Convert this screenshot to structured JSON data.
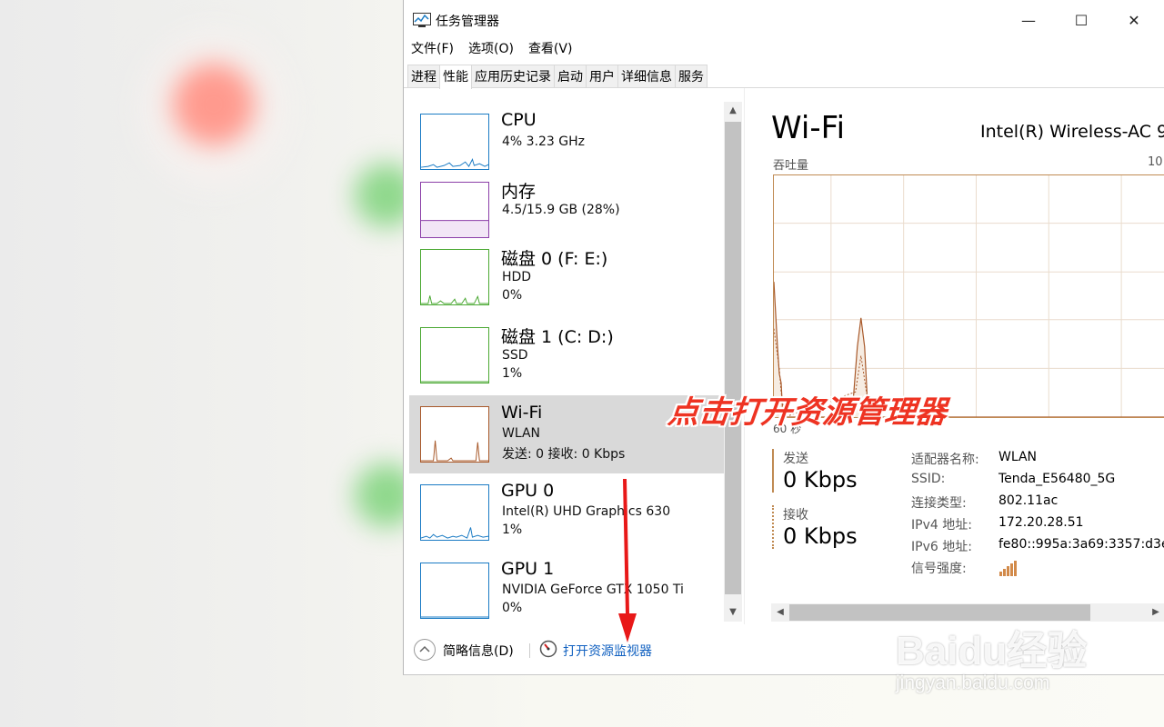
{
  "window": {
    "title": "任务管理器",
    "controls": {
      "minimize": "—",
      "maximize": "☐",
      "close": "✕"
    }
  },
  "menu": [
    "文件(F)",
    "选项(O)",
    "查看(V)"
  ],
  "tabs": [
    "进程",
    "性能",
    "应用历史记录",
    "启动",
    "用户",
    "详细信息",
    "服务"
  ],
  "active_tab": "性能",
  "devices": [
    {
      "name": "CPU",
      "sub1": "4% 3.23 GHz",
      "sub2": "",
      "color": "#1a7bc4",
      "level": 0.04
    },
    {
      "name": "内存",
      "sub1": "4.5/15.9 GB (28%)",
      "sub2": "",
      "color": "#8b3fa8",
      "level": 0.28
    },
    {
      "name": "磁盘 0 (F: E:)",
      "sub1": "HDD",
      "sub2": "0%",
      "color": "#4aa832",
      "level": 0.0
    },
    {
      "name": "磁盘 1 (C: D:)",
      "sub1": "SSD",
      "sub2": "1%",
      "color": "#4aa832",
      "level": 0.01
    },
    {
      "name": "Wi-Fi",
      "sub1": "WLAN",
      "sub2": "发送: 0 接收: 0 Kbps",
      "color": "#a8592a",
      "level": 0.0,
      "selected": true
    },
    {
      "name": "GPU 0",
      "sub1": "Intel(R) UHD Graphics 630",
      "sub2": "1%",
      "color": "#1a7bc4",
      "level": 0.01
    },
    {
      "name": "GPU 1",
      "sub1": "NVIDIA GeForce GTX 1050 Ti",
      "sub2": "0%",
      "color": "#1a7bc4",
      "level": 0.0
    }
  ],
  "detail": {
    "title": "Wi-Fi",
    "adapter": "Intel(R) Wireless-AC 9",
    "throughput_label": "吞吐量",
    "throughput_max": "10",
    "throughput_min": "60 秒",
    "send_label": "发送",
    "send_value": "0 Kbps",
    "recv_label": "接收",
    "recv_value": "0 Kbps",
    "properties": [
      {
        "key": "适配器名称:",
        "value": "WLAN"
      },
      {
        "key": "SSID:",
        "value": "Tenda_E56480_5G"
      },
      {
        "key": "连接类型:",
        "value": "802.11ac"
      },
      {
        "key": "IPv4 地址:",
        "value": "172.20.28.51"
      },
      {
        "key": "IPv6 地址:",
        "value": "fe80::995a:3a69:3357:d3e"
      },
      {
        "key": "信号强度:",
        "value": ""
      }
    ],
    "accent": "#c08a52"
  },
  "footer": {
    "fewer_details": "简略信息(D)",
    "resource_monitor": "打开资源监视器"
  },
  "annotation": "点击打开资源管理器",
  "watermark": {
    "logo": "Baidu经验",
    "url": "jingyan.baidu.com"
  }
}
